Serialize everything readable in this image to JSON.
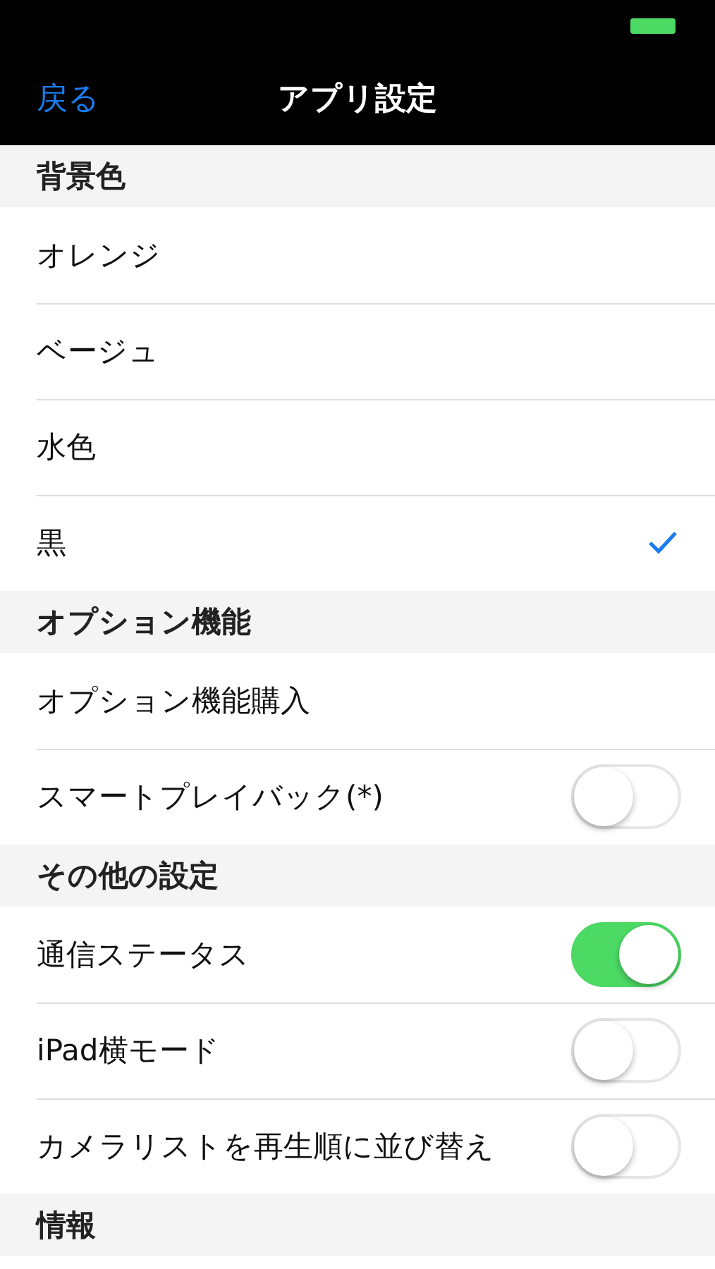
{
  "nav": {
    "back": "戻る",
    "title": "アプリ設定"
  },
  "sections": [
    {
      "header": "背景色",
      "rows": [
        {
          "kind": "check",
          "label": "オレンジ",
          "selected": false
        },
        {
          "kind": "check",
          "label": "ベージュ",
          "selected": false
        },
        {
          "kind": "check",
          "label": "水色",
          "selected": false
        },
        {
          "kind": "check",
          "label": "黒",
          "selected": true
        }
      ]
    },
    {
      "header": "オプション機能",
      "rows": [
        {
          "kind": "plain",
          "label": "オプション機能購入"
        },
        {
          "kind": "toggle",
          "label": "スマートプレイバック(*)",
          "on": false
        }
      ]
    },
    {
      "header": "その他の設定",
      "rows": [
        {
          "kind": "toggle",
          "label": "通信ステータス",
          "on": true
        },
        {
          "kind": "toggle",
          "label": "iPad横モード",
          "on": false
        },
        {
          "kind": "toggle",
          "label": "カメラリストを再生順に並び替え",
          "on": false
        }
      ]
    },
    {
      "header": "情報"
    }
  ]
}
